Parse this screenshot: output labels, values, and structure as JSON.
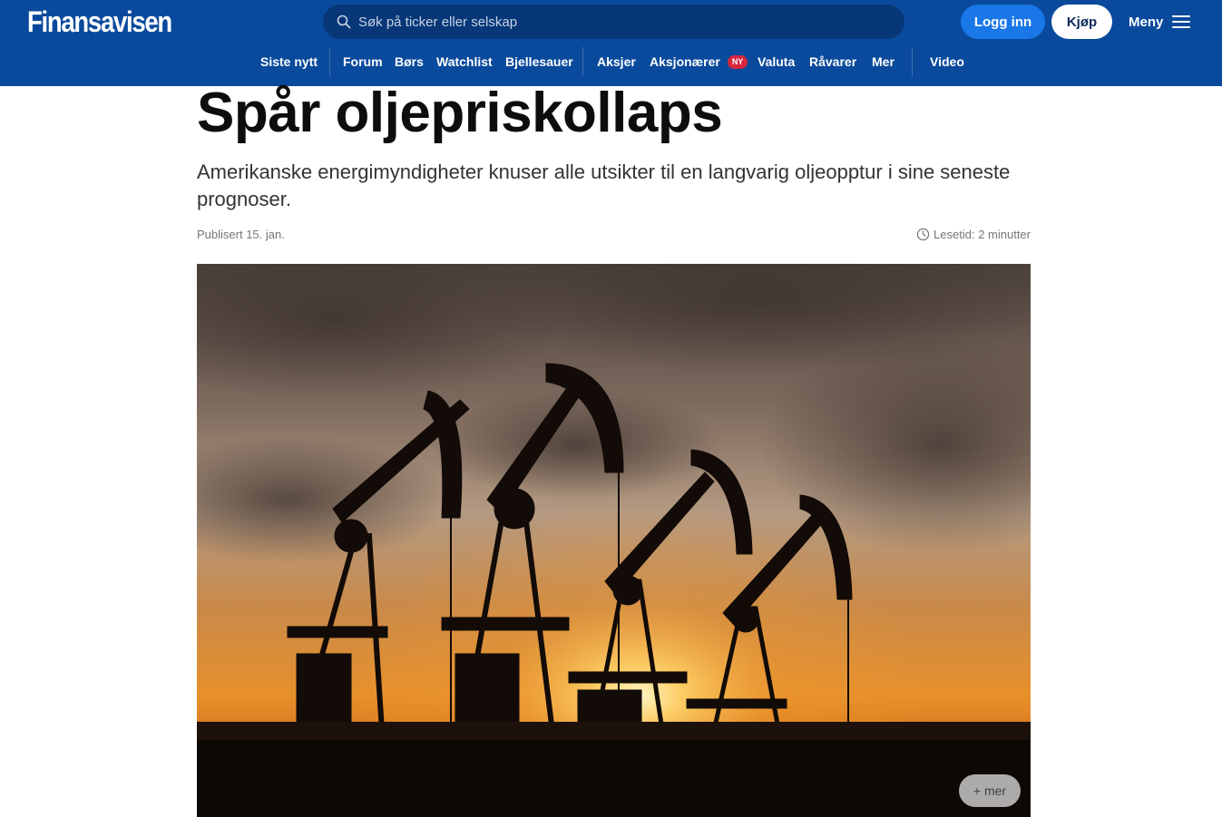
{
  "header": {
    "logo": "Finansavisen",
    "search": {
      "placeholder": "Søk på ticker eller selskap",
      "icon": "search-icon"
    },
    "login_label": "Logg inn",
    "buy_label": "Kjøp",
    "menu_label": "Meny"
  },
  "nav": {
    "items": [
      {
        "label": "Siste nytt"
      },
      {
        "label": "Forum"
      },
      {
        "label": "Børs"
      },
      {
        "label": "Watchlist"
      },
      {
        "label": "Bjellesauer"
      },
      {
        "label": "Aksjer"
      },
      {
        "label": "Aksjonærer",
        "badge": "NY"
      },
      {
        "label": "Valuta"
      },
      {
        "label": "Råvarer"
      },
      {
        "label": "Mer"
      },
      {
        "label": "Video"
      }
    ]
  },
  "article": {
    "title": "Spår oljepriskollaps",
    "lead": "Amerikanske energimyndigheter knuser alle utsikter til en langvarig oljeopptur i sine seneste prognoser.",
    "published": "Publisert 15. jan.",
    "reading_time": "Lesetid: 2 minutter",
    "image_more_label": "+ mer"
  },
  "colors": {
    "header_bg": "#0a4a9c",
    "login_button": "#1977e8",
    "badge": "#d7263d"
  }
}
